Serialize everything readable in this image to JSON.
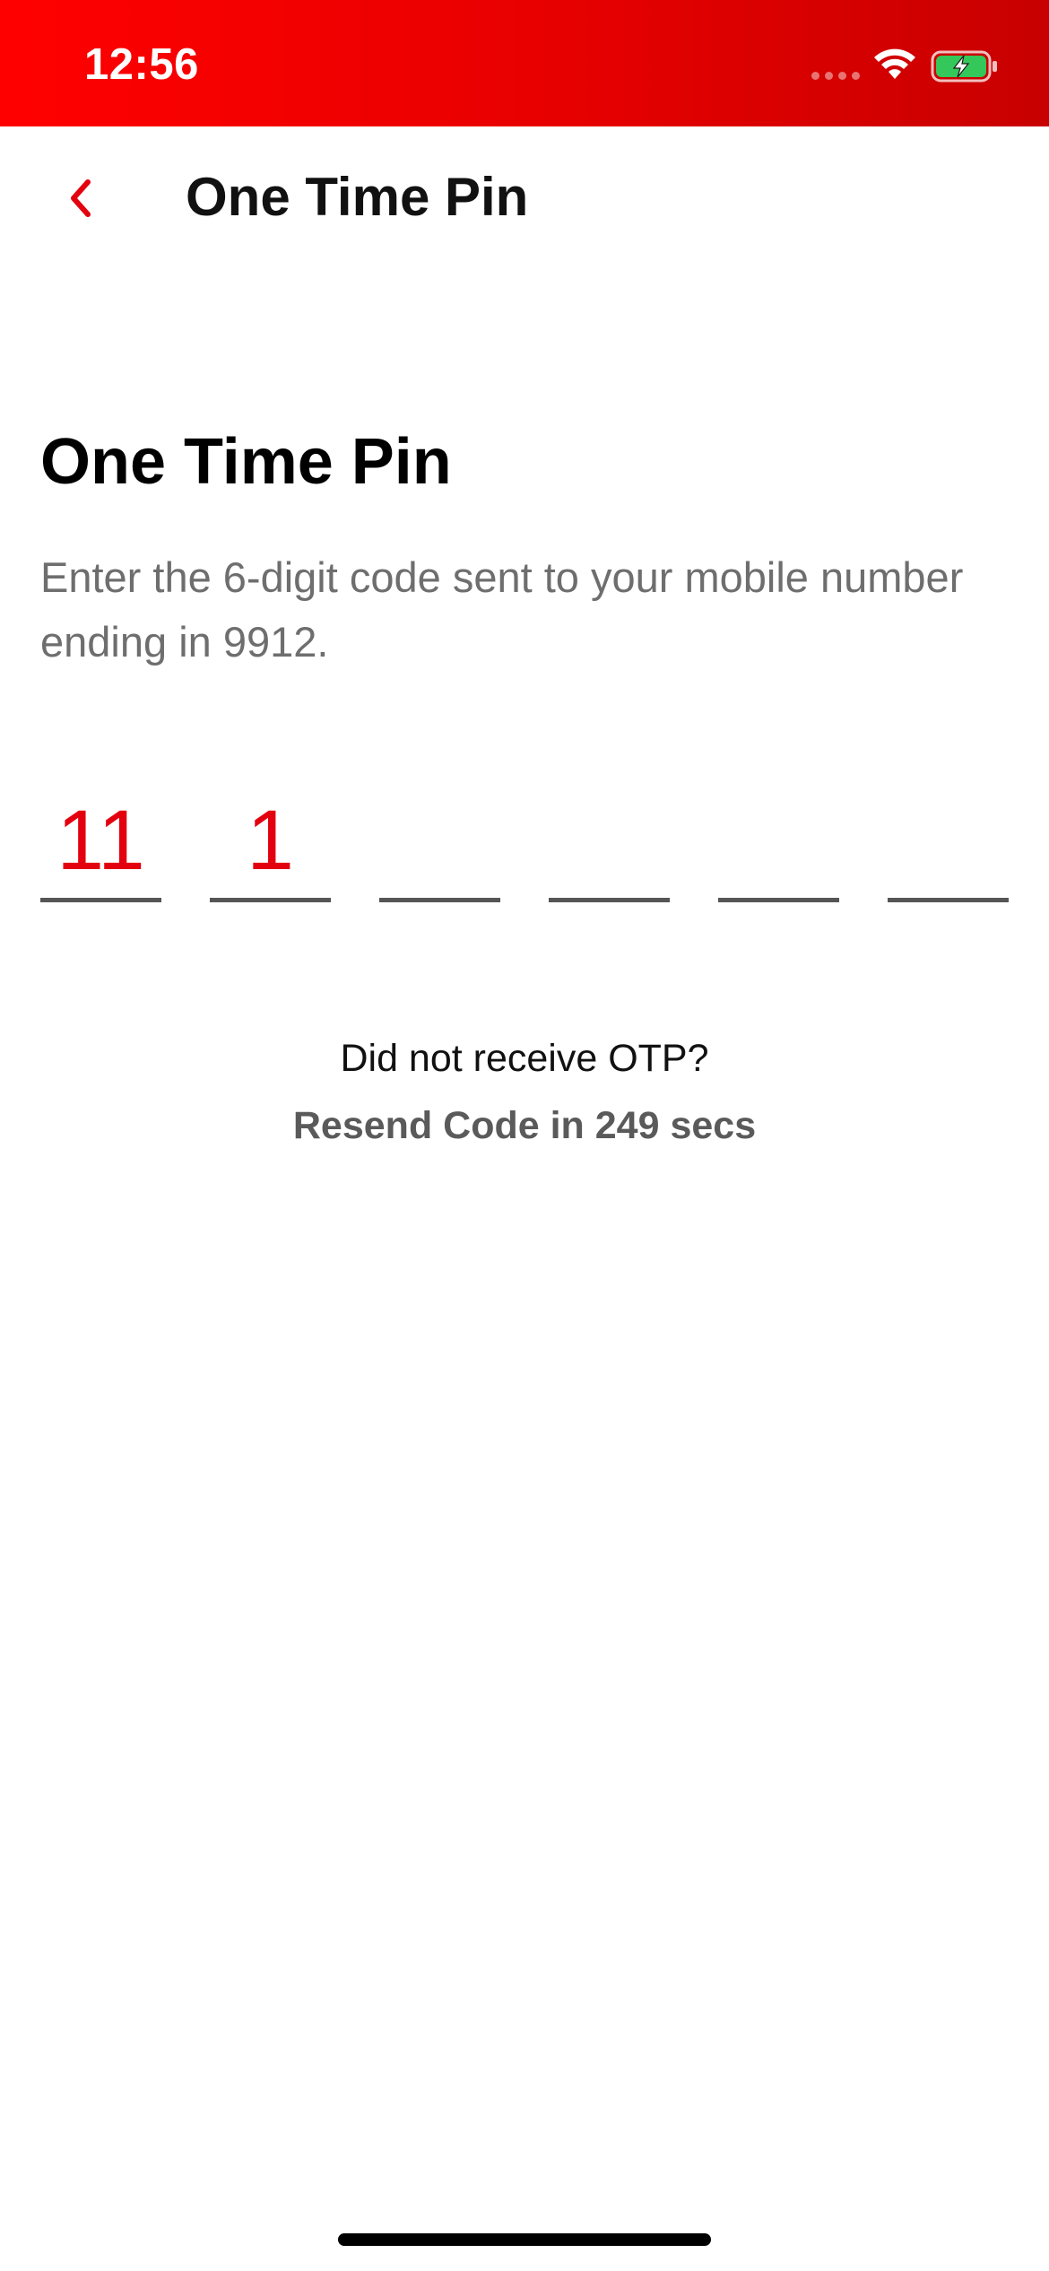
{
  "status_bar": {
    "time": "12:56",
    "background_color": "#e60000",
    "icons": [
      "cellular-dots-icon",
      "wifi-icon",
      "battery-charging-icon"
    ]
  },
  "nav": {
    "back_icon": "chevron-left-icon",
    "title": "One Time Pin"
  },
  "main": {
    "title": "One Time Pin",
    "description": "Enter the 6-digit code sent to your mobile number ending in 9912.",
    "otp": {
      "length": 6,
      "digits": [
        "11",
        "1",
        "",
        "",
        "",
        ""
      ]
    },
    "not_received_text": "Did not receive OTP?",
    "resend_text": "Resend Code in 249 secs"
  },
  "colors": {
    "accent": "#e3000f",
    "status_bar": "#e60000",
    "text_primary": "#111111",
    "text_secondary": "#6e6e6e"
  }
}
